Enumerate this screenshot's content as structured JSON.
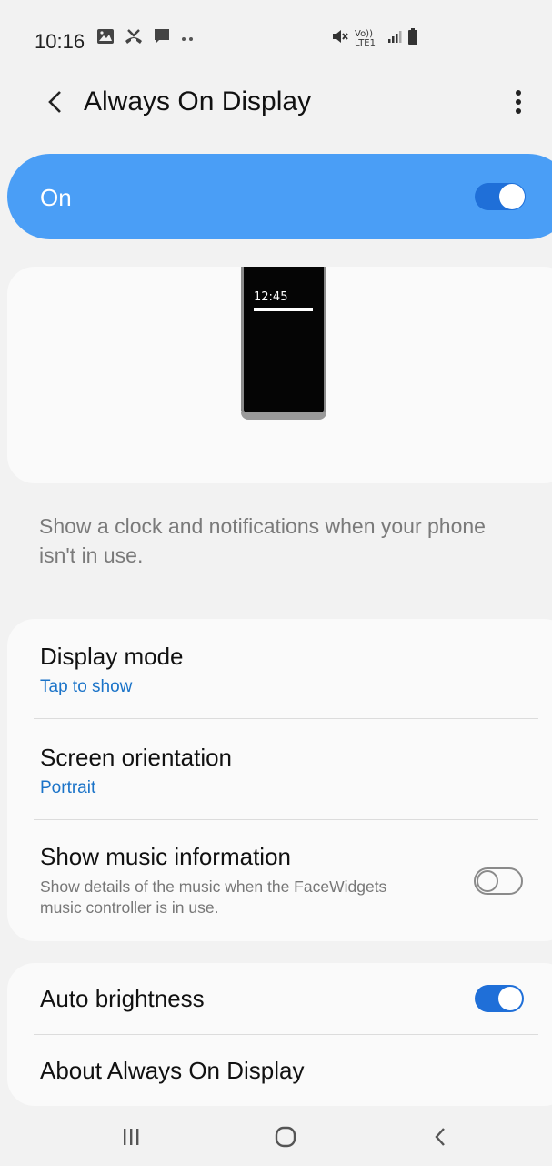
{
  "status_bar": {
    "time": "10:16",
    "left_icons": [
      "gallery-icon",
      "missed-call-icon",
      "message-icon",
      "more-dots-icon"
    ],
    "right_icons": [
      "mute-icon",
      "volte-lte-icon",
      "signal-icon",
      "battery-icon"
    ],
    "lte_label": "Vo)) LTE1"
  },
  "app_bar": {
    "title": "Always On Display"
  },
  "master_switch": {
    "label": "On",
    "enabled": true,
    "color": "#4a9ef6"
  },
  "preview": {
    "clock_text": "12:45"
  },
  "description": "Show a clock and notifications when your phone isn't in use.",
  "settings": {
    "display_mode": {
      "title": "Display mode",
      "value": "Tap to show"
    },
    "screen_orientation": {
      "title": "Screen orientation",
      "value": "Portrait"
    },
    "music_info": {
      "title": "Show music information",
      "description": "Show details of the music when the FaceWidgets music controller is in use.",
      "enabled": false
    },
    "auto_brightness": {
      "title": "Auto brightness",
      "enabled": true
    },
    "about": {
      "title": "About Always On Display"
    }
  },
  "nav_bar": {
    "buttons": [
      "recents-icon",
      "home-icon",
      "back-icon"
    ]
  },
  "colors": {
    "accent": "#1f6fd8",
    "link": "#1a73c8",
    "background": "#f2f2f2"
  }
}
